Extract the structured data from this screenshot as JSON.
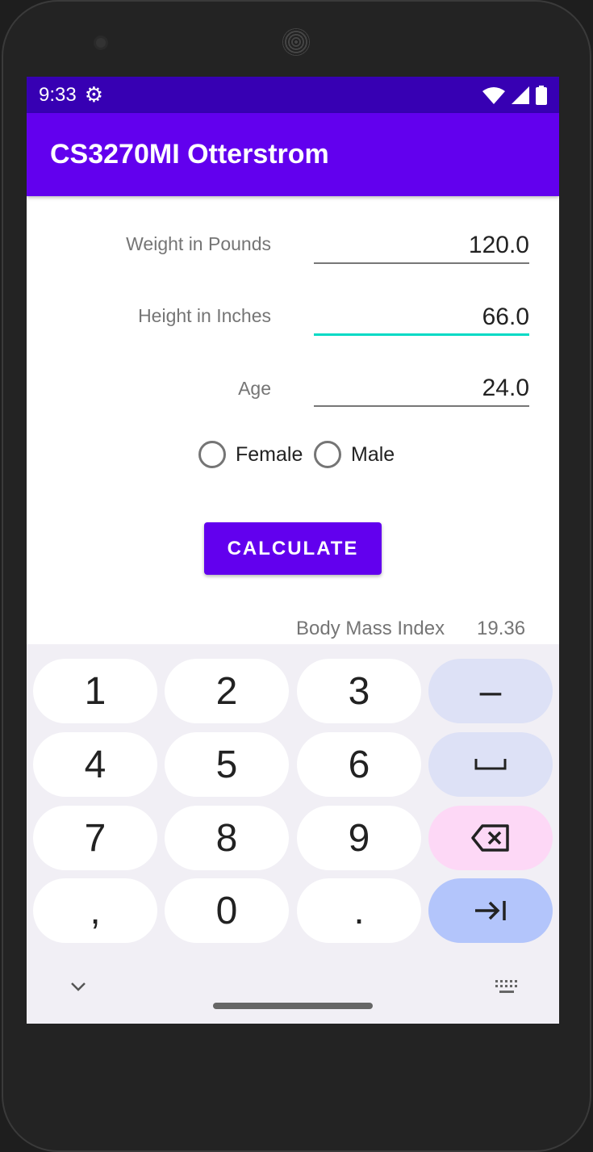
{
  "status_bar": {
    "time": "9:33",
    "icons": [
      "settings-icon",
      "wifi-icon",
      "signal-icon",
      "battery-icon"
    ]
  },
  "app_bar": {
    "title": "CS3270MI Otterstrom"
  },
  "form": {
    "weight": {
      "label": "Weight in Pounds",
      "value": "120.0"
    },
    "height": {
      "label": "Height in Inches",
      "value": "66.0"
    },
    "age": {
      "label": "Age",
      "value": "24.0"
    },
    "gender": {
      "female": "Female",
      "male": "Male",
      "selected": null
    },
    "calculate": "CALCULATE",
    "bmi_label": "Body Mass Index",
    "bmi_value": "19.36"
  },
  "colors": {
    "primary": "#6200ee",
    "primary_dark": "#3700b3",
    "accent": "#03dac5"
  },
  "keyboard": {
    "keys": [
      "1",
      "2",
      "3",
      "–",
      "4",
      "5",
      "6",
      "space",
      "7",
      "8",
      "9",
      "backspace",
      ",",
      "0",
      ".",
      "tab"
    ]
  }
}
